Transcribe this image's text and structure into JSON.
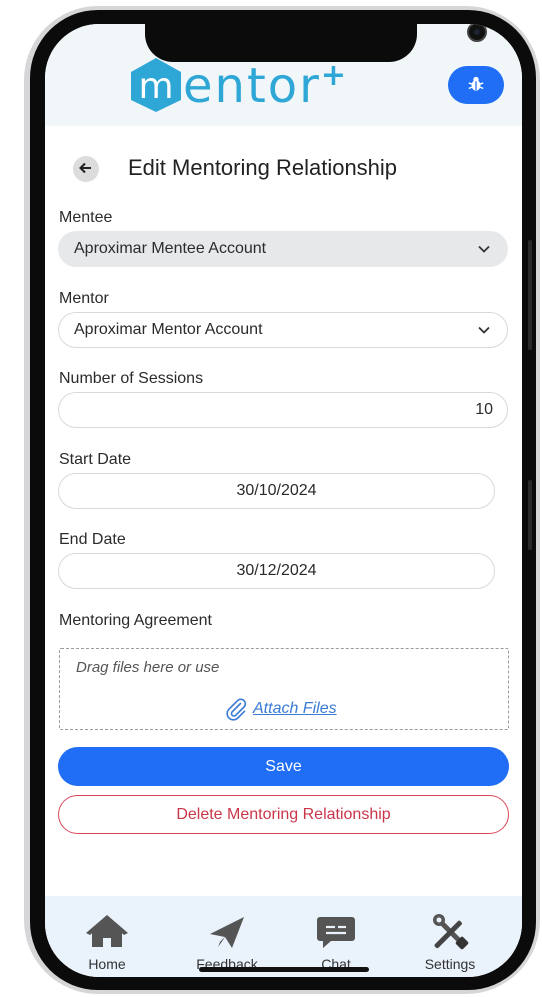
{
  "header": {
    "logo_letter": "m",
    "logo_text": "entor",
    "logo_plus": "+",
    "bug_icon": "bug-icon"
  },
  "page": {
    "title": "Edit Mentoring Relationship",
    "back_icon": "arrow-left-icon"
  },
  "form": {
    "mentee_label": "Mentee",
    "mentee_value": "Aproximar Mentee Account",
    "mentor_label": "Mentor",
    "mentor_value": "Aproximar Mentor Account",
    "sessions_label": "Number of Sessions",
    "sessions_value": "10",
    "start_label": "Start Date",
    "start_value": "30/10/2024",
    "end_label": "End Date",
    "end_value": "30/12/2024",
    "agreement_label": "Mentoring Agreement",
    "drop_hint": "Drag files here or use",
    "attach_label": "Attach Files"
  },
  "actions": {
    "save_label": "Save",
    "delete_label": "Delete Mentoring Relationship"
  },
  "nav": {
    "items": [
      {
        "label": "Home",
        "icon": "home-icon"
      },
      {
        "label": "Feedback",
        "icon": "paper-plane-icon"
      },
      {
        "label": "Chat",
        "icon": "chat-bubble-icon"
      },
      {
        "label": "Settings",
        "icon": "tools-icon"
      }
    ]
  },
  "colors": {
    "primary": "#1f6ef5",
    "logo": "#2fa7d6",
    "danger": "#c9364a",
    "nav_bg": "#eaf3fb"
  }
}
